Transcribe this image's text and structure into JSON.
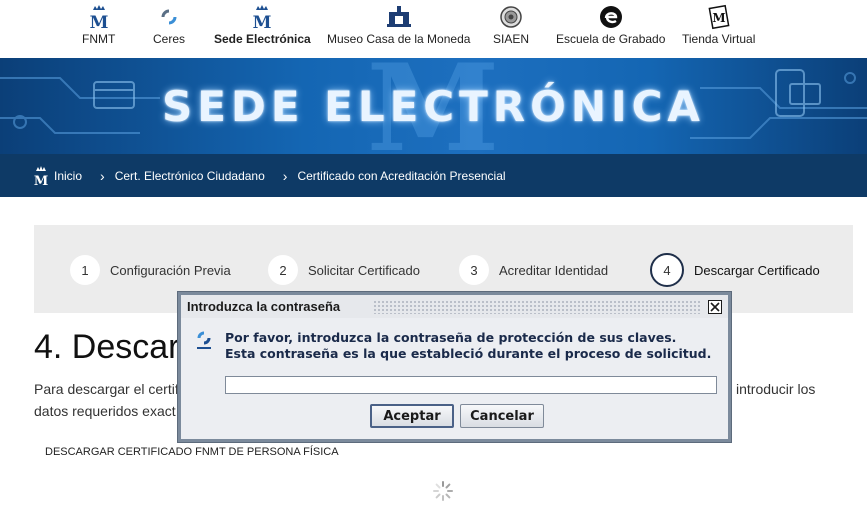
{
  "topnav": {
    "items": [
      {
        "label": "FNMT",
        "icon": "crown-m-icon"
      },
      {
        "label": "Ceres",
        "icon": "ceres-icon"
      },
      {
        "label": "Sede Electrónica",
        "icon": "crown-m-icon"
      },
      {
        "label": "Museo Casa de la Moneda",
        "icon": "museum-icon"
      },
      {
        "label": "SIAEN",
        "icon": "siaen-seal-icon"
      },
      {
        "label": "Escuela de Grabado",
        "icon": "engraving-school-icon"
      },
      {
        "label": "Tienda Virtual",
        "icon": "virtual-shop-icon"
      }
    ]
  },
  "banner": {
    "title": "SEDE ELECTRÓNICA"
  },
  "breadcrumb": {
    "items": [
      "Inicio",
      "Cert. Electrónico Ciudadano",
      "Certificado con Acreditación Presencial"
    ]
  },
  "steps": [
    {
      "num": "1",
      "label": "Configuración Previa"
    },
    {
      "num": "2",
      "label": "Solicitar Certificado"
    },
    {
      "num": "3",
      "label": "Acreditar Identidad"
    },
    {
      "num": "4",
      "label": "Descargar Certificado"
    }
  ],
  "content": {
    "heading": "4. Descar",
    "para_left_line1": "Para descargar el certif",
    "para_left_line2": "datos requeridos exact",
    "para_right": "introducir los",
    "download_label": "DESCARGAR CERTIFICADO FNMT DE PERSONA FÍSICA"
  },
  "dialog": {
    "title": "Introduzca la contraseña",
    "message_line1": "Por favor, introduzca la contraseña de protección de sus claves.",
    "message_line2": "Esta contraseña es la que estableció durante el proceso de solicitud.",
    "password_value": "",
    "ok_label": "Aceptar",
    "cancel_label": "Cancelar"
  },
  "colors": {
    "breadcrumb_bg": "#0e3a66",
    "banner_text": "#e9f4ff",
    "steps_bg": "#ececec"
  }
}
